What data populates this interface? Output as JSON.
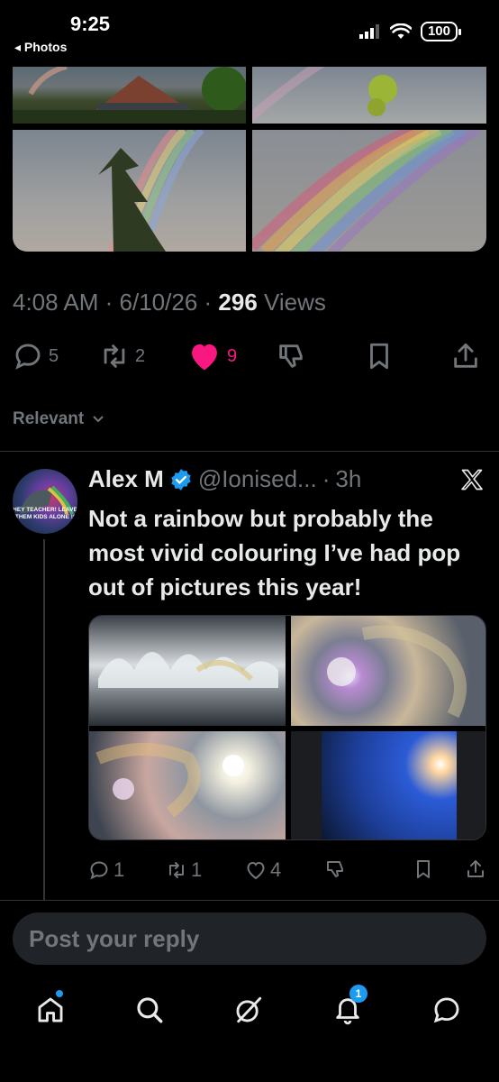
{
  "status_bar": {
    "time": "9:25",
    "back_app": "◂ Photos",
    "battery": "100"
  },
  "tweet": {
    "time": "4:08 AM",
    "date": "6/10/26",
    "views_count": "296",
    "views_label": "Views",
    "actions": {
      "replies": "5",
      "reposts": "2",
      "likes": "9"
    }
  },
  "sort": {
    "label": "Relevant"
  },
  "reply": {
    "name": "Alex M",
    "handle": "@Ionised...",
    "time": "3h",
    "avatar_text": "HEY TEACHER! LEAVE THEM KIDS ALONE !!",
    "text": "Not a rainbow but probably the most vivid colouring I’ve had pop out of pictures this year!",
    "actions": {
      "replies": "1",
      "reposts": "1",
      "likes": "4"
    }
  },
  "compose": {
    "placeholder": "Post your reply"
  },
  "nav": {
    "notifications_badge": "1"
  },
  "colors": {
    "accent": "#1d9bf0",
    "like": "#f91880",
    "muted": "#71767b",
    "text": "#e7e9ea",
    "background": "#000000"
  }
}
